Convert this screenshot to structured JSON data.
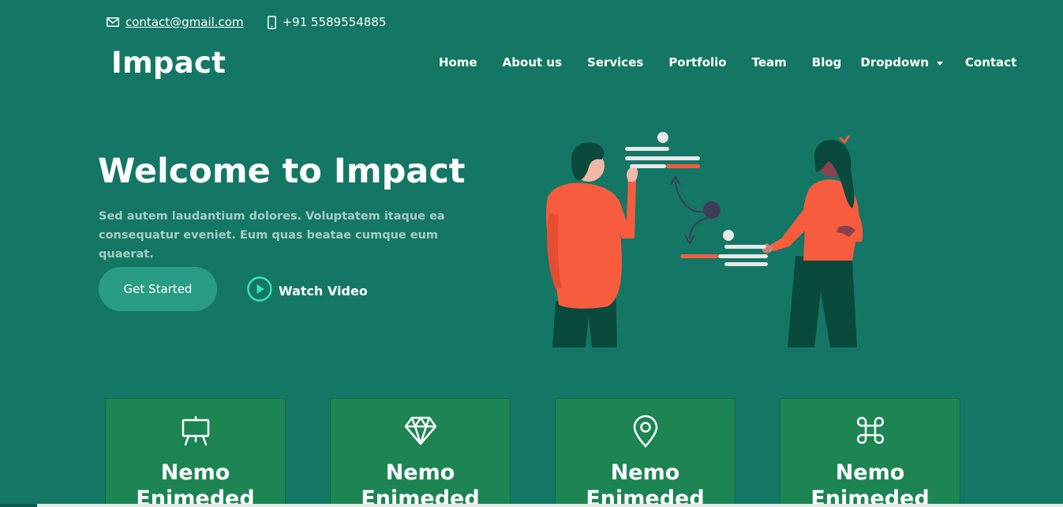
{
  "topbar": {
    "email": "contact@gmail.com",
    "phone": "+91 5589554885",
    "email_icon": "envelope-icon",
    "phone_icon": "phone-icon"
  },
  "header": {
    "logo": "Impact",
    "nav": [
      "Home",
      "About us",
      "Services",
      "Portfolio",
      "Team",
      "Blog",
      "Dropdown",
      "Contact"
    ]
  },
  "hero": {
    "title": "Welcome to Impact",
    "description": "Sed autem laudantium dolores. Voluptatem itaque ea consequatur eveniet. Eum quas beatae cumque eum quaerat.",
    "get_started": "Get Started",
    "watch_video": "Watch Video"
  },
  "cards": [
    {
      "title": "Nemo Enimeded",
      "icon": "easel-icon"
    },
    {
      "title": "Nemo Enimeded",
      "icon": "gem-icon"
    },
    {
      "title": "Nemo Enimeded",
      "icon": "map-pin-icon"
    },
    {
      "title": "Nemo Enimeded",
      "icon": "command-icon"
    }
  ],
  "colors": {
    "background": "#147765",
    "button": "#299c85",
    "card": "#1d8553",
    "accent_orange": "#f75c3f",
    "accent_play": "#39e2b6"
  }
}
